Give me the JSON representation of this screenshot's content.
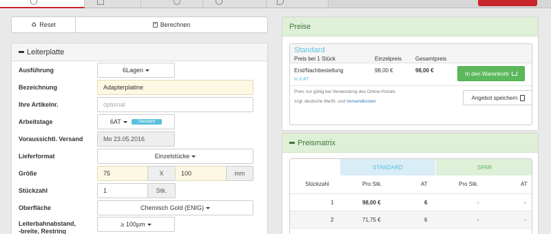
{
  "toolbar": {
    "reset_label": "Reset",
    "calc_label": "Berechnen"
  },
  "leiterplatte": {
    "title": "Leiterplatte",
    "ausfuehrung": {
      "label": "Ausführung",
      "value": "6Lagen"
    },
    "bezeichnung": {
      "label": "Bezeichnung",
      "value": "Adapterplatine"
    },
    "artikelnr": {
      "label": "Ihre Artikelnr.",
      "placeholder": "optional"
    },
    "arbeitstage": {
      "label": "Arbeitstage",
      "value": "6AT",
      "badge": "Standard"
    },
    "versand": {
      "label": "Voraussichtl. Versand",
      "value": "Mo 23.05.2016"
    },
    "lieferformat": {
      "label": "Lieferformat",
      "value": "Einzelstücke"
    },
    "groesse": {
      "label": "Größe",
      "width": "75",
      "sep": "X",
      "height": "100",
      "unit": "mm"
    },
    "stueckzahl": {
      "label": "Stückzahl",
      "value": "1",
      "unit": "Stk."
    },
    "oberflaeche": {
      "label": "Oberfläche",
      "value": "Chemisch Gold (ENIG)"
    },
    "leiterbahn": {
      "label_line1": "Leiterbahnabstand,",
      "label_line2": "-breite, Restring",
      "value": "≥ 100µm"
    }
  },
  "preise": {
    "title": "Preise",
    "box_title": "Standard",
    "col_header": "Preis bei 1 Stück",
    "col_einzel": "Einzelpreis",
    "col_gesamt": "Gesamtpreis",
    "item_label": "Erst/Nachbestellung",
    "item_sub": "in 6 AT",
    "einzelpreis": "98,00 €",
    "gesamtpreis": "98,00 €",
    "cart_label": "In den Warenkorb",
    "note_line1": "Preis nur gültig bei Verwendung des Online-Portals",
    "note_line2_prefix": "zzgl. deutsche MwSt. und",
    "note_link": "Versandkosten",
    "save_label": "Angebot speichern"
  },
  "matrix": {
    "title": "Preismatrix",
    "header_std": "STANDARD",
    "header_spar": "SPAR",
    "col_stueckzahl": "Stückzahl",
    "col_pro_stk": "Pro Stk.",
    "col_at": "AT",
    "col_pro_stk_spar": "Pro Stk.",
    "col_at_spar": "AT",
    "rows": [
      {
        "qty": "1",
        "price": "98,00 €",
        "at": "6",
        "spar_price": "-",
        "spar_at": "-"
      },
      {
        "qty": "2",
        "price": "71,75 €",
        "at": "6",
        "spar_price": "-",
        "spar_at": "-"
      }
    ]
  }
}
